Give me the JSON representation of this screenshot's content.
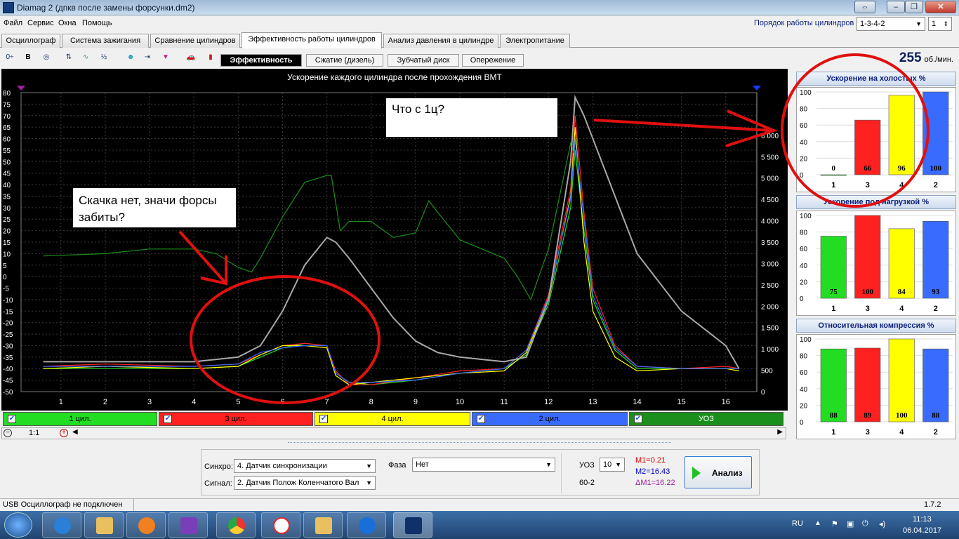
{
  "window": {
    "title": "Diamag 2 (дпкв после замены форсунки.dm2)"
  },
  "menu": {
    "file": "Файл",
    "service": "Сервис",
    "windows": "Окна",
    "help": "Помощь"
  },
  "firing_order": {
    "label": "Порядок работы цилиндров",
    "value": "1-3-4-2",
    "count": "1"
  },
  "tabs": [
    "Осциллограф",
    "Система зажигания",
    "Сравнение цилиндров",
    "Эффективность работы цилиндров",
    "Анализ давления в цилиндре",
    "Электропитание"
  ],
  "subtabs": [
    "Эффективность",
    "Сжатие (дизель)",
    "Зубчатый диск",
    "Опережение"
  ],
  "rpm": {
    "value": "255",
    "unit": "об./мин."
  },
  "chart_data": [
    {
      "type": "line",
      "title": "Ускорение каждого цилиндра после прохождения ВМТ",
      "y_left": {
        "range": [
          -50,
          80
        ],
        "ticks": [
          "80",
          "75",
          "70",
          "65",
          "60",
          "55",
          "50",
          "45",
          "40",
          "35",
          "30",
          "25",
          "20",
          "15",
          "10",
          "5",
          "0",
          "-5",
          "-10",
          "-15",
          "-20",
          "-25",
          "-30",
          "-35",
          "-40",
          "-45",
          "-50"
        ]
      },
      "y_right": {
        "range": [
          0,
          6500
        ],
        "ticks": [
          "6 000",
          "5 500",
          "5 000",
          "4 500",
          "4 000",
          "3 500",
          "3 000",
          "2 500",
          "2 000",
          "1 500",
          "1 000",
          "500",
          "0"
        ]
      },
      "x_ticks": [
        "1",
        "2",
        "3",
        "4",
        "5",
        "6",
        "7",
        "8",
        "9",
        "10",
        "11",
        "12",
        "13",
        "14",
        "15",
        "16"
      ],
      "series": [
        {
          "name": "1 цил.",
          "color": "#22dd22",
          "x": [
            0.6,
            2,
            4,
            5,
            5.5,
            6,
            6.5,
            7,
            7.2,
            7.5,
            8,
            9,
            10,
            11,
            11.5,
            12,
            12.5,
            12.6,
            12.8,
            13,
            13.5,
            14,
            15,
            16,
            16.3
          ],
          "y": [
            -40,
            -40,
            -40,
            -39,
            -35,
            -31,
            -29,
            -30,
            -42,
            -46,
            -47,
            -45,
            -42,
            -40,
            -34,
            -12,
            30,
            55,
            20,
            -10,
            -32,
            -40,
            -40,
            -40,
            -40
          ]
        },
        {
          "name": "3 цил.",
          "color": "#ff2020",
          "x": [
            0.6,
            2,
            4,
            5,
            5.5,
            6,
            6.5,
            7,
            7.2,
            7.5,
            8,
            9,
            10,
            11,
            11.5,
            12,
            12.5,
            12.6,
            12.8,
            13,
            13.5,
            14,
            15,
            16,
            16.3
          ],
          "y": [
            -39,
            -38,
            -39,
            -38,
            -34,
            -30,
            -29,
            -30,
            -41,
            -47,
            -47,
            -44,
            -41,
            -40,
            -32,
            -8,
            38,
            70,
            28,
            -5,
            -30,
            -39,
            -40,
            -39,
            -40
          ]
        },
        {
          "name": "4 цил.",
          "color": "#ffff00",
          "x": [
            0.6,
            2,
            4,
            5,
            5.5,
            6,
            6.5,
            7,
            7.2,
            7.5,
            8,
            9,
            10,
            11,
            11.5,
            12,
            12.5,
            12.6,
            12.8,
            13,
            13.5,
            14,
            15,
            16,
            16.3
          ],
          "y": [
            -40,
            -39,
            -40,
            -39,
            -34,
            -30,
            -30,
            -31,
            -43,
            -47,
            -46,
            -44,
            -42,
            -41,
            -33,
            -10,
            35,
            65,
            15,
            -15,
            -35,
            -41,
            -40,
            -40,
            -41
          ]
        },
        {
          "name": "2 цил.",
          "color": "#3a6bff",
          "x": [
            0.6,
            2,
            4,
            5,
            5.5,
            6,
            6.5,
            7,
            7.2,
            7.5,
            8,
            9,
            10,
            11,
            11.5,
            12,
            12.5,
            12.6,
            12.8,
            13,
            13.5,
            14,
            15,
            16,
            16.3
          ],
          "y": [
            -39,
            -39,
            -39,
            -38,
            -33,
            -31,
            -30,
            -30,
            -42,
            -46,
            -46,
            -45,
            -42,
            -40,
            -32,
            -9,
            34,
            60,
            25,
            -8,
            -31,
            -39,
            -40,
            -40,
            -40
          ]
        },
        {
          "name": "УОЗ",
          "color": "#1b8f1b",
          "x": [
            0.6,
            2,
            3,
            4,
            4.5,
            5,
            5.3,
            5.5,
            6,
            6.5,
            7,
            7.1,
            7.3,
            7.5,
            8,
            8.5,
            9,
            9.3,
            9.5,
            10,
            10.5,
            11,
            11.3,
            11.6,
            12,
            12.5,
            12.6
          ],
          "y": [
            9,
            10,
            12,
            12,
            10,
            4,
            2,
            8,
            26,
            41,
            44,
            44,
            20,
            24,
            24,
            17,
            19,
            33,
            28,
            16,
            12,
            8,
            0,
            -10,
            12,
            58,
            52
          ]
        },
        {
          "name": "",
          "color": "#a8a8a8",
          "x": [
            0.6,
            2,
            3,
            4,
            4.5,
            5,
            5.5,
            6,
            6.5,
            7,
            7.2,
            7.5,
            8,
            8.5,
            9,
            9.5,
            10,
            10.5,
            11,
            11.5,
            12,
            12.5,
            12.6,
            12.8,
            13,
            14,
            15,
            16,
            16.3
          ],
          "y": [
            -37,
            -37,
            -37,
            -37,
            -36,
            -35,
            -30,
            -15,
            5,
            17,
            15,
            8,
            -5,
            -18,
            -28,
            -33,
            -35,
            -36,
            -37,
            -35,
            -10,
            50,
            78,
            70,
            60,
            10,
            -15,
            -30,
            -40
          ]
        }
      ]
    },
    {
      "type": "bar",
      "title": "Ускорение на холостых %",
      "categories": [
        "1",
        "3",
        "4",
        "2"
      ],
      "values": [
        0,
        66,
        96,
        100
      ],
      "colors": [
        "#22dd22",
        "#ff2020",
        "#ffff00",
        "#3a6bff"
      ],
      "ylim": [
        0,
        100
      ],
      "y_ticks": [
        "100",
        "80",
        "60",
        "40",
        "20",
        "0"
      ]
    },
    {
      "type": "bar",
      "title": "Ускорение под нагрузкой %",
      "categories": [
        "1",
        "3",
        "4",
        "2"
      ],
      "values": [
        75,
        100,
        84,
        93
      ],
      "colors": [
        "#22dd22",
        "#ff2020",
        "#ffff00",
        "#3a6bff"
      ],
      "ylim": [
        0,
        100
      ],
      "y_ticks": [
        "100",
        "80",
        "60",
        "40",
        "20",
        "0"
      ]
    },
    {
      "type": "bar",
      "title": "Относительная компрессия %",
      "categories": [
        "1",
        "3",
        "4",
        "2"
      ],
      "values": [
        88,
        89,
        100,
        88
      ],
      "colors": [
        "#22dd22",
        "#ff2020",
        "#ffff00",
        "#3a6bff"
      ],
      "ylim": [
        0,
        100
      ],
      "y_ticks": [
        "100",
        "80",
        "60",
        "40",
        "20",
        "0"
      ]
    }
  ],
  "legend": [
    "1 цил.",
    "3 цил.",
    "4 цил.",
    "2 цил.",
    "УОЗ"
  ],
  "legend_colors": [
    "#22dd22",
    "#ff2020",
    "#ffff00",
    "#3a6bff",
    "#1b8f1b"
  ],
  "scale": {
    "value": "1:1"
  },
  "bottom": {
    "sync_label": "Синхро:",
    "sync_value": "4.  Датчик синхронизации",
    "signal_label": "Сигнал:",
    "signal_value": "2.  Датчик Полож Коленчатого Вал",
    "phase_label": "Фаза",
    "phase_value": "Нет",
    "uoz_label": "УОЗ",
    "uoz_value": "10",
    "teeth": "60-2",
    "m1": "M1=0.21",
    "m2": "M2=16.43",
    "dm1": "ΔM1=16.22",
    "analyze": "Анализ"
  },
  "status": {
    "usb": "USB Осциллограф не подключен",
    "version": "1.7.2"
  },
  "annotations": {
    "first": "Что с 1ц?",
    "second": "Скачка нет, значи форсы забиты?"
  },
  "taskbar": {
    "lang": "RU",
    "time": "11:13",
    "date": "06.04.2017"
  }
}
